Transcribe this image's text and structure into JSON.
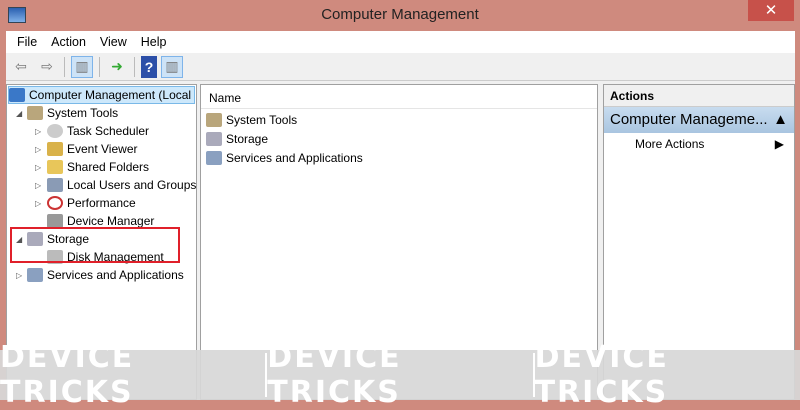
{
  "window": {
    "title": "Computer Management",
    "close": "✕"
  },
  "menu": [
    "File",
    "Action",
    "View",
    "Help"
  ],
  "tree": {
    "root": "Computer Management (Local",
    "system_tools": "System Tools",
    "children": [
      "Task Scheduler",
      "Event Viewer",
      "Shared Folders",
      "Local Users and Groups",
      "Performance",
      "Device Manager"
    ],
    "storage": "Storage",
    "disk": "Disk Management",
    "services": "Services and Applications"
  },
  "middle": {
    "header": "Name",
    "items": [
      "System Tools",
      "Storage",
      "Services and Applications"
    ]
  },
  "actions": {
    "header": "Actions",
    "section": "Computer Manageme...",
    "item": "More Actions"
  },
  "watermark": "DEVICE TRICKS"
}
